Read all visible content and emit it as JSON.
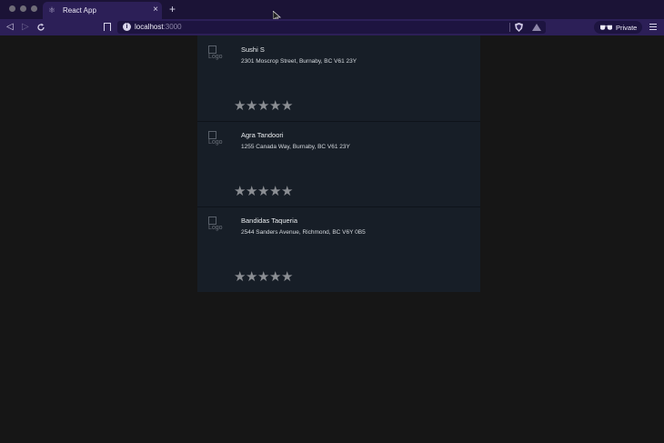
{
  "browser": {
    "tab_title": "React App",
    "tab_close": "×",
    "new_tab": "+",
    "url_host": "localhost",
    "url_port": ":3000",
    "private_label": "Private"
  },
  "restaurants": [
    {
      "logo_alt": "Logo",
      "name": "Sushi S",
      "address": "2301 Moscrop Street, Burnaby, BC V61 23Y",
      "rating": 0,
      "stars": [
        "★",
        "★",
        "★",
        "★",
        "★"
      ]
    },
    {
      "logo_alt": "Logo",
      "name": "Agra Tandoori",
      "address": "1255 Canada Way, Burnaby, BC V61 23Y",
      "rating": 0,
      "stars": [
        "★",
        "★",
        "★",
        "★",
        "★"
      ]
    },
    {
      "logo_alt": "Logo",
      "name": "Bandidas Taqueria",
      "address": "2544 Sanders Avenue, Richmond, BC V6Y 0B5",
      "rating": 0,
      "stars": [
        "★",
        "★",
        "★",
        "★",
        "★"
      ]
    }
  ],
  "colors": {
    "titlebar": "#1b1336",
    "toolbar": "#2c1f57",
    "card": "#171e27",
    "star_empty": "#8b8e93"
  }
}
